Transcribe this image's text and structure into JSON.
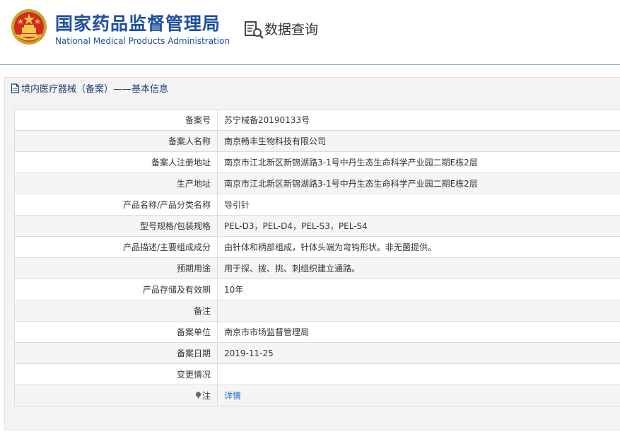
{
  "header": {
    "org_cn": "国家药品监督管理局",
    "org_en": "National Medical Products Administration",
    "query_title": "数据查询",
    "emblem_icon": "national-emblem-icon",
    "query_icon": "document-search-icon",
    "brand_color": "#1e4fa0"
  },
  "panel": {
    "title": "境内医疗器械（备案）——基本信息",
    "title_icon": "document-icon"
  },
  "rows": [
    {
      "label": "备案号",
      "value": "苏宁械备20190133号"
    },
    {
      "label": "备案人名称",
      "value": "南京畅丰生物科技有限公司"
    },
    {
      "label": "备案人注册地址",
      "value": "南京市江北新区新锦湖路3-1号中丹生态生命科学产业园二期E栋2层"
    },
    {
      "label": "生产地址",
      "value": "南京市江北新区新锦湖路3-1号中丹生态生命科学产业园二期E栋2层"
    },
    {
      "label": "产品名称/产品分类名称",
      "value": "导引针"
    },
    {
      "label": "型号规格/包装规格",
      "value": "PEL-D3，PEL-D4，PEL-S3，PEL-S4"
    },
    {
      "label": "产品描述/主要组成成分",
      "value": "由针体和柄部组成，针体头端为弯钩形状。非无菌提供。"
    },
    {
      "label": "预期用途",
      "value": "用于探、拨、挑、刺组织建立通路。"
    },
    {
      "label": "产品存储及有效期",
      "value": "10年"
    },
    {
      "label": "备注",
      "value": ""
    },
    {
      "label": "备案单位",
      "value": "南京市市场监督管理局"
    },
    {
      "label": "备案日期",
      "value": "2019-11-25"
    },
    {
      "label": "变更情况",
      "value": ""
    }
  ],
  "note": {
    "label": "注",
    "icon": "pin-icon",
    "link_text": "详情",
    "link_color": "#2a6ac0"
  }
}
